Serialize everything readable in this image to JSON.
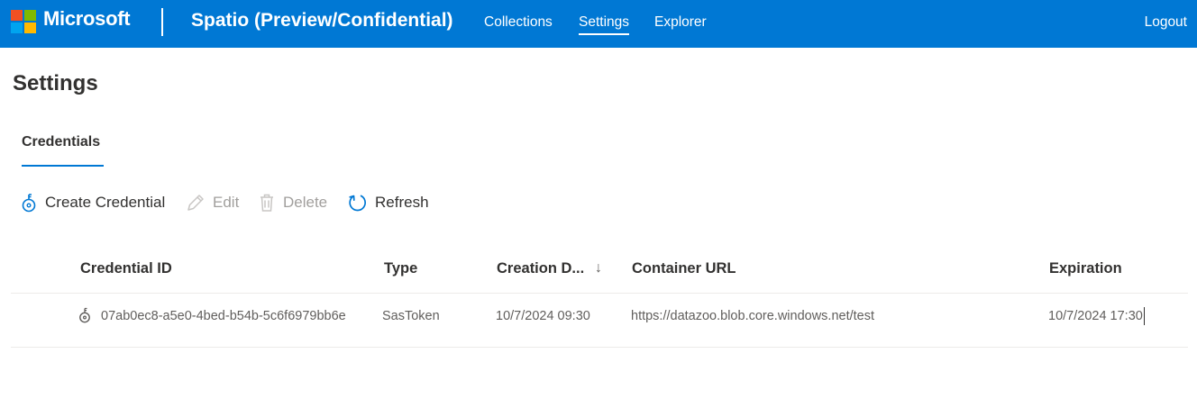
{
  "header": {
    "brand": "Microsoft",
    "app_title": "Spatio (Preview/Confidential)",
    "nav": [
      {
        "label": "Collections",
        "active": false
      },
      {
        "label": "Settings",
        "active": true
      },
      {
        "label": "Explorer",
        "active": false
      }
    ],
    "logout_label": "Logout",
    "colors": {
      "bar": "#0078d4",
      "text": "#ffffff"
    }
  },
  "page": {
    "title": "Settings",
    "tabs": [
      {
        "label": "Credentials",
        "selected": true
      }
    ]
  },
  "toolbar": {
    "create_label": "Create Credential",
    "create_icon": "key-add-icon",
    "edit_label": "Edit",
    "edit_icon": "pencil-icon",
    "edit_disabled": true,
    "delete_label": "Delete",
    "delete_icon": "trash-icon",
    "delete_disabled": true,
    "refresh_label": "Refresh",
    "refresh_icon": "refresh-icon"
  },
  "table": {
    "columns": [
      "Credential ID",
      "Type",
      "Creation D...",
      "Container URL",
      "Expiration"
    ],
    "sorted_column": "Creation D...",
    "sort_direction": "descending",
    "rows": [
      {
        "icon": "key-icon",
        "credential_id": "07ab0ec8-a5e0-4bed-b54b-5c6f6979bb6e",
        "type": "SasToken",
        "creation_date": "10/7/2024 09:30",
        "container_url": "https://datazoo.blob.core.windows.net/test",
        "expiration": "10/7/2024 17:30"
      }
    ]
  }
}
